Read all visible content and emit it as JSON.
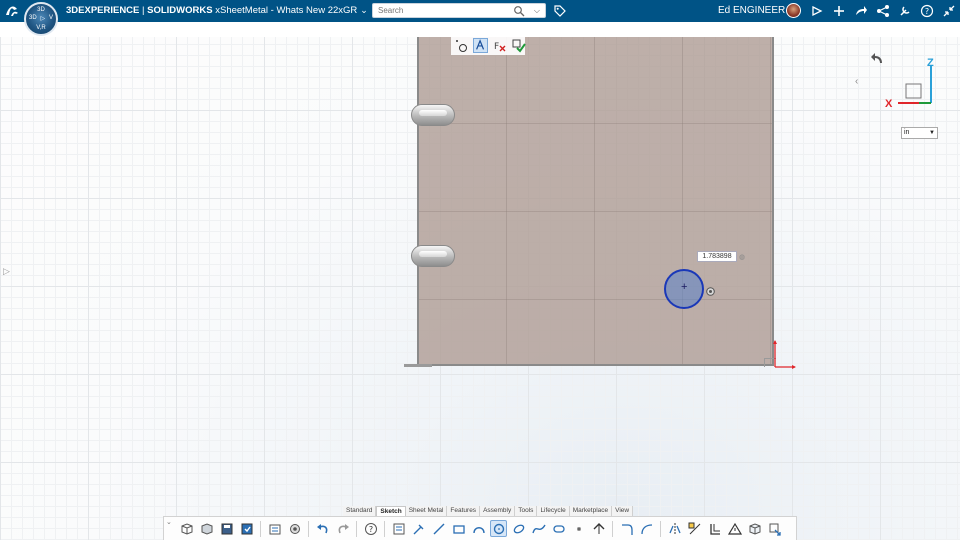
{
  "topbar": {
    "brand_prefix": "3DEXPERIENCE",
    "brand_separator": " | ",
    "brand_app": "SOLIDWORKS",
    "document_title": " xSheetMetal - Whats New 22xGR",
    "search_placeholder": "Search",
    "user_name": "Ed ENGINEER",
    "compass": {
      "top": "3D",
      "left": "3D",
      "right": "V",
      "bottom": "V,R"
    }
  },
  "canvas": {
    "dimension_value": "1.783898",
    "unit": "in"
  },
  "view_triad": {
    "x_label": "X",
    "z_label": "Z"
  },
  "command_tabs": [
    {
      "label": "Standard"
    },
    {
      "label": "Sketch",
      "active": true
    },
    {
      "label": "Sheet Metal"
    },
    {
      "label": "Features"
    },
    {
      "label": "Assembly"
    },
    {
      "label": "Tools"
    },
    {
      "label": "Lifecycle"
    },
    {
      "label": "Marketplace"
    },
    {
      "label": "View"
    }
  ],
  "colors": {
    "topbar": "#005386",
    "sheet_fill": "#b09e96",
    "selection_circle": "#1a38b8",
    "axis_x": "#e0262b",
    "axis_z": "#2aa0d8"
  }
}
